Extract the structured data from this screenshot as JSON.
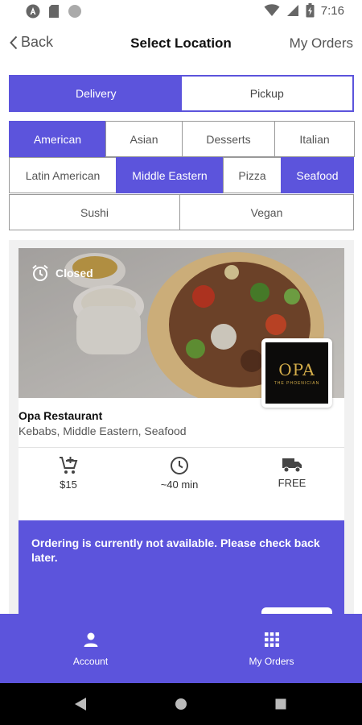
{
  "status_bar": {
    "time": "7:16",
    "left_icons": [
      "a-circle-icon",
      "sd-card-icon",
      "circle-icon"
    ],
    "right_icons": [
      "wifi-icon",
      "signal-icon",
      "battery-icon"
    ]
  },
  "header": {
    "back_label": "Back",
    "title": "Select Location",
    "right_label": "My Orders"
  },
  "mode_toggle": {
    "options": [
      {
        "label": "Delivery",
        "selected": true
      },
      {
        "label": "Pickup",
        "selected": false
      }
    ]
  },
  "categories": {
    "rows": [
      [
        {
          "label": "American",
          "selected": true
        },
        {
          "label": "Asian",
          "selected": false
        },
        {
          "label": "Desserts",
          "selected": false
        },
        {
          "label": "Italian",
          "selected": false
        }
      ],
      [
        {
          "label": "Latin American",
          "selected": false
        },
        {
          "label": "Middle Eastern",
          "selected": true
        },
        {
          "label": "Pizza",
          "selected": false
        },
        {
          "label": "Seafood",
          "selected": true
        }
      ],
      [
        {
          "label": "Sushi",
          "selected": false
        },
        {
          "label": "Vegan",
          "selected": false
        }
      ]
    ]
  },
  "restaurant": {
    "status": "Closed",
    "logo_text": "OPA",
    "logo_subtext": "THE PHOENICIAN",
    "name": "Opa Restaurant",
    "cuisine": "Kebabs, Middle Eastern, Seafood",
    "stats": [
      {
        "icon": "cart-add-icon",
        "value": "$15"
      },
      {
        "icon": "clock-icon",
        "value": "~40 min"
      },
      {
        "icon": "truck-icon",
        "value": "FREE"
      }
    ],
    "notice": "Ordering is currently not available. Please check back later."
  },
  "bottom_nav": {
    "items": [
      {
        "label": "Account",
        "icon": "person-icon"
      },
      {
        "label": "My Orders",
        "icon": "grid-icon"
      }
    ]
  },
  "colors": {
    "accent": "#5c54dc",
    "system_nav": "#000000"
  }
}
